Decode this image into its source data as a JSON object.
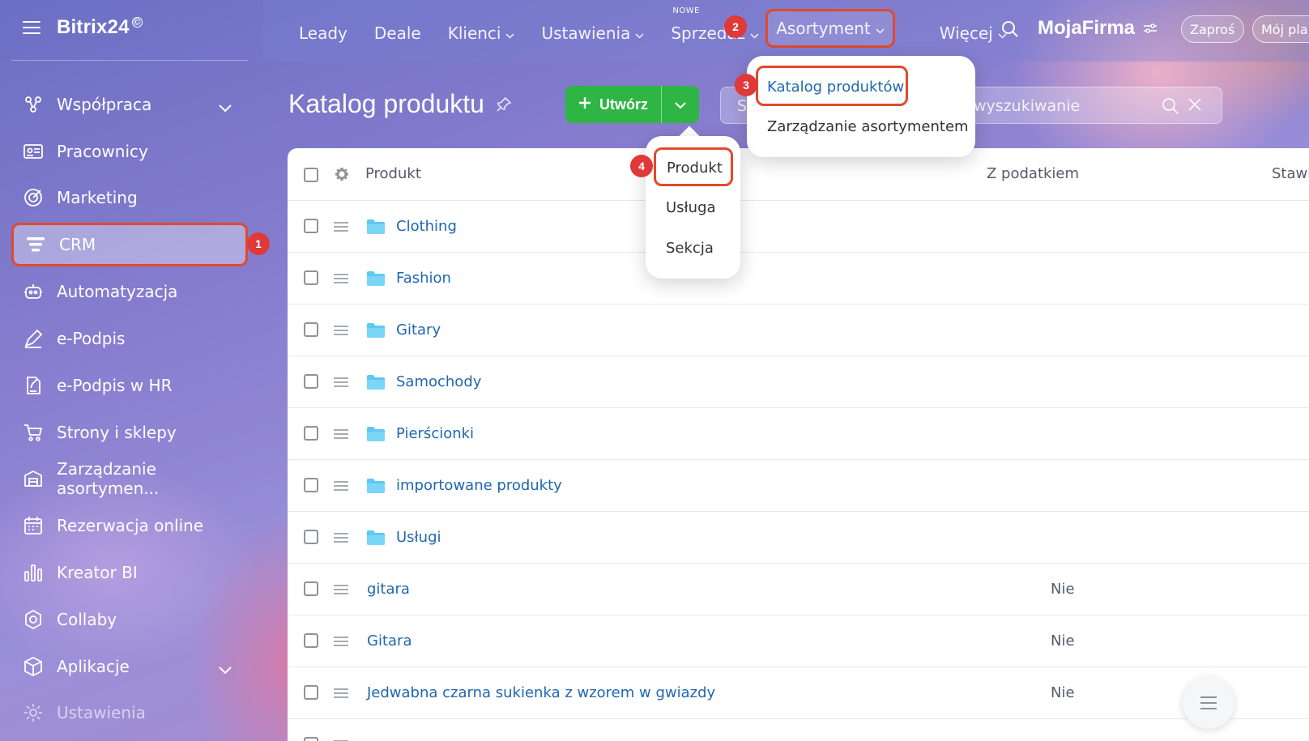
{
  "app": {
    "logo": "Bitrix24",
    "logo_mark": "©"
  },
  "sidebar": {
    "items": [
      {
        "label": "Współpraca",
        "icon": "collaboration-icon",
        "has_chevron": true
      },
      {
        "label": "Pracownicy",
        "icon": "employees-icon"
      },
      {
        "label": "Marketing",
        "icon": "marketing-icon"
      },
      {
        "label": "CRM",
        "icon": "crm-funnel-icon",
        "active": true
      },
      {
        "label": "Automatyzacja",
        "icon": "automation-icon"
      },
      {
        "label": "e-Podpis",
        "icon": "signature-icon"
      },
      {
        "label": "e-Podpis w HR",
        "icon": "hr-signature-icon"
      },
      {
        "label": "Strony i sklepy",
        "icon": "cart-icon"
      },
      {
        "label": "Zarządzanie asortymen...",
        "icon": "inventory-icon"
      },
      {
        "label": "Rezerwacja online",
        "icon": "calendar-icon"
      },
      {
        "label": "Kreator BI",
        "icon": "bar-chart-icon"
      },
      {
        "label": "Collaby",
        "icon": "collaby-icon"
      },
      {
        "label": "Aplikacje",
        "icon": "apps-icon",
        "has_chevron": true
      },
      {
        "label": "Ustawienia",
        "icon": "settings-gear-icon"
      }
    ]
  },
  "topnav": {
    "items": [
      {
        "label": "Leady"
      },
      {
        "label": "Deale"
      },
      {
        "label": "Klienci",
        "caret": true
      },
      {
        "label": "Ustawienia",
        "caret": true
      },
      {
        "label": "Sprzedaż",
        "caret": true,
        "badge": "NOWE"
      },
      {
        "label": "Asortyment",
        "caret": true
      },
      {
        "label": "Więcej",
        "caret": true
      }
    ],
    "company": "MojaFirma",
    "invite": "Zaproś",
    "plan": "Mój pla"
  },
  "toolbar": {
    "title": "Katalog produktu",
    "create_label": "Utwórz",
    "filter_left": "S",
    "search_placeholder": "wyszukiwanie"
  },
  "table": {
    "columns": {
      "product": "Produkt",
      "tax": "Z podatkiem",
      "rate": "Stawk"
    },
    "rows": [
      {
        "name": "Clothing",
        "folder": true,
        "tax": ""
      },
      {
        "name": "Fashion",
        "folder": true,
        "tax": ""
      },
      {
        "name": "Gitary",
        "folder": true,
        "tax": ""
      },
      {
        "name": "Samochody",
        "folder": true,
        "tax": ""
      },
      {
        "name": "Pierścionki",
        "folder": true,
        "tax": ""
      },
      {
        "name": "importowane produkty",
        "folder": true,
        "tax": ""
      },
      {
        "name": "Usługi",
        "folder": true,
        "tax": ""
      },
      {
        "name": "gitara",
        "folder": false,
        "tax": "Nie"
      },
      {
        "name": "Gitara",
        "folder": false,
        "tax": "Nie"
      },
      {
        "name": "Jedwabna czarna sukienka z wzorem w gwiazdy",
        "folder": false,
        "tax": "Nie"
      }
    ]
  },
  "asortyment_menu": {
    "items": [
      "Katalog produktów",
      "Zarządzanie asortymentem"
    ]
  },
  "create_menu": {
    "items": [
      "Produkt",
      "Usługa",
      "Sekcja"
    ]
  },
  "step_badges": [
    "1",
    "2",
    "3",
    "4"
  ],
  "colors": {
    "accent_red": "#e04a2c",
    "badge_red": "#e0393a",
    "create_green": "#2fb544",
    "link_blue": "#2067b0"
  }
}
